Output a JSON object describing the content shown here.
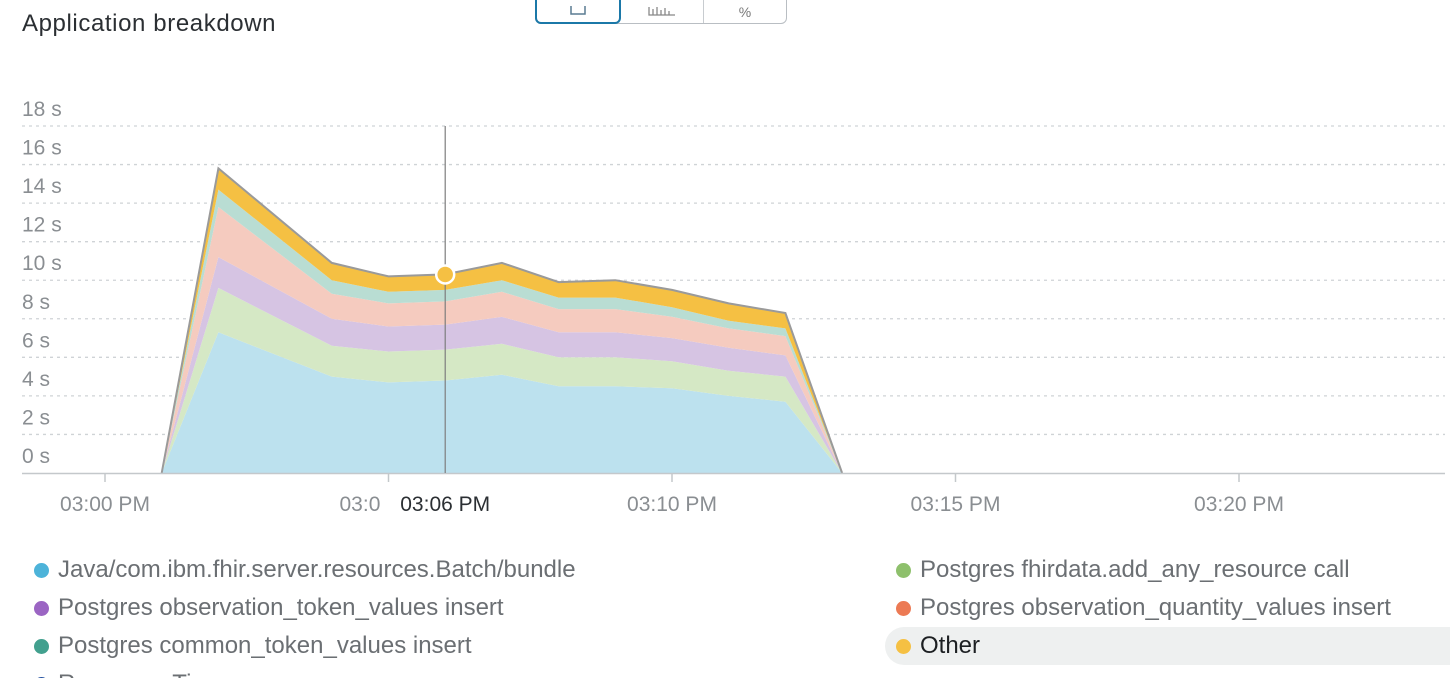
{
  "title": "Application breakdown",
  "view_toggle": {
    "buttons": [
      "stacked-area-view",
      "bar-view",
      "percent-view"
    ],
    "active": 0,
    "percent_label": "%"
  },
  "colors": {
    "grid": "#cfd3d6",
    "axis_text": "#8a8e92",
    "crosshair": "#7d7d7d",
    "outline": "#9a9a9a"
  },
  "chart_data": {
    "type": "area",
    "stacked": true,
    "x": [
      "03:01 PM",
      "03:02 PM",
      "03:04 PM",
      "03:05 PM",
      "03:06 PM",
      "03:07 PM",
      "03:08 PM",
      "03:09 PM",
      "03:10 PM",
      "03:11 PM",
      "03:12 PM",
      "03:13 PM"
    ],
    "series": [
      {
        "name": "Java/com.ibm.fhir.server.resources.Batch/bundle",
        "color": "#4db3d9",
        "fill": "#bce1ee",
        "values": [
          0,
          7.3,
          5.0,
          4.7,
          4.8,
          5.1,
          4.5,
          4.5,
          4.4,
          4.0,
          3.7,
          0
        ]
      },
      {
        "name": "Postgres fhirdata.add_any_resource call",
        "color": "#8ec06c",
        "fill": "#d5e8c5",
        "values": [
          0,
          2.3,
          1.6,
          1.6,
          1.6,
          1.6,
          1.5,
          1.5,
          1.4,
          1.3,
          1.3,
          0
        ]
      },
      {
        "name": "Postgres observation_token_values insert",
        "color": "#9b65c3",
        "fill": "#d6c4e3",
        "values": [
          0,
          1.6,
          1.4,
          1.3,
          1.3,
          1.4,
          1.3,
          1.3,
          1.2,
          1.2,
          1.1,
          0
        ]
      },
      {
        "name": "Postgres observation_quantity_values insert",
        "color": "#ec7a54",
        "fill": "#f5cbbf",
        "values": [
          0,
          2.6,
          1.3,
          1.2,
          1.2,
          1.3,
          1.2,
          1.2,
          1.1,
          1.0,
          1.0,
          0
        ]
      },
      {
        "name": "Postgres common_token_values insert",
        "color": "#42a08e",
        "fill": "#b9ddd3",
        "values": [
          0,
          0.9,
          0.7,
          0.6,
          0.6,
          0.6,
          0.6,
          0.6,
          0.5,
          0.4,
          0.4,
          0
        ]
      },
      {
        "name": "Other",
        "color": "#f5c043",
        "fill": "#f5c043",
        "values": [
          0,
          1.1,
          0.9,
          0.8,
          0.8,
          0.9,
          0.8,
          0.9,
          0.9,
          0.9,
          0.8,
          0
        ]
      }
    ],
    "x_axis": {
      "ticks": [
        "03:00 PM",
        "03:05 PM",
        "03:10 PM",
        "03:15 PM",
        "03:20 PM"
      ],
      "range": [
        "03:00 PM",
        "03:25 PM"
      ],
      "partial_tick_text": "03:0"
    },
    "y_axis": {
      "unit": "s",
      "ticks": [
        "0 s",
        "2 s",
        "4 s",
        "6 s",
        "8 s",
        "10 s",
        "12 s",
        "14 s",
        "16 s",
        "18 s"
      ],
      "range": [
        0,
        18
      ]
    },
    "grid": true,
    "crosshair": {
      "label": "03:06 PM",
      "highlighted_series": "Other"
    },
    "legend": {
      "position": "bottom",
      "items": [
        {
          "label": "Java/com.ibm.fhir.server.resources.Batch/bundle",
          "color": "#4db3d9"
        },
        {
          "label": "Postgres fhirdata.add_any_resource call",
          "color": "#8ec06c"
        },
        {
          "label": "Postgres observation_token_values insert",
          "color": "#9b65c3"
        },
        {
          "label": "Postgres observation_quantity_values insert",
          "color": "#ec7a54"
        },
        {
          "label": "Postgres common_token_values insert",
          "color": "#42a08e"
        },
        {
          "label": "Other",
          "color": "#f5c043",
          "highlighted": true
        },
        {
          "label": "Response Time",
          "color": "#2350a0",
          "truncated": true
        }
      ]
    }
  }
}
